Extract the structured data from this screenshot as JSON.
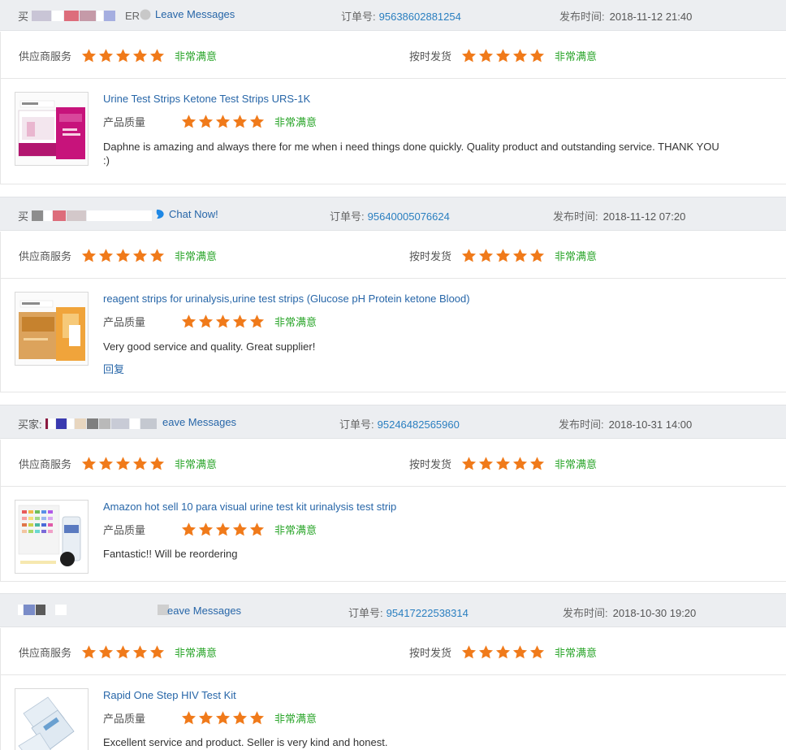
{
  "colors": {
    "star": "#f07a1a",
    "link": "#2766a8",
    "order_number": "#2a7fc0",
    "satisfied": "#2aa52a",
    "header_bg": "#eceef1"
  },
  "labels": {
    "order_prefix": "订单号:",
    "date_prefix": "发布时间:",
    "supplier_service": "供应商服务",
    "on_time_delivery": "按时发货",
    "product_quality": "产品质量",
    "very_satisfied": "非常满意"
  },
  "reviews": [
    {
      "buyer_label": "买",
      "buyer_suffix": "ER",
      "action_label": "Leave Messages",
      "order_number": "95638602881254",
      "date": "2018-11-12 21:40",
      "supplier_rating": 5,
      "delivery_rating": 5,
      "quality_rating": 5,
      "product_title": "Urine Test Strips Ketone Test Strips URS-1K",
      "comment": "Daphne is amazing and always there for me when i need things done quickly. Quality product and outstanding service. THANK YOU :)"
    },
    {
      "buyer_label": "买",
      "action_label": "Chat Now!",
      "order_number": "95640005076624",
      "date": "2018-11-12 07:20",
      "supplier_rating": 5,
      "delivery_rating": 5,
      "quality_rating": 5,
      "product_title": "reagent strips for urinalysis,urine test strips (Glucose pH Protein ketone Blood)",
      "comment": "Very good service and quality. Great supplier!",
      "reply_label": "回复"
    },
    {
      "buyer_label": "买家:",
      "action_label": "eave Messages",
      "order_number": "95246482565960",
      "date": "2018-10-31 14:00",
      "supplier_rating": 5,
      "delivery_rating": 5,
      "quality_rating": 5,
      "product_title": "Amazon hot sell 10 para visual urine test kit urinalysis test strip",
      "comment": "Fantastic!! Will be reordering"
    },
    {
      "action_label": "eave Messages",
      "order_number": "95417222538314",
      "date": "2018-10-30 19:20",
      "supplier_rating": 5,
      "delivery_rating": 5,
      "quality_rating": 5,
      "product_title": "Rapid One Step HIV Test Kit",
      "comment": "Excellent service and product. Seller is very kind and honest."
    }
  ]
}
